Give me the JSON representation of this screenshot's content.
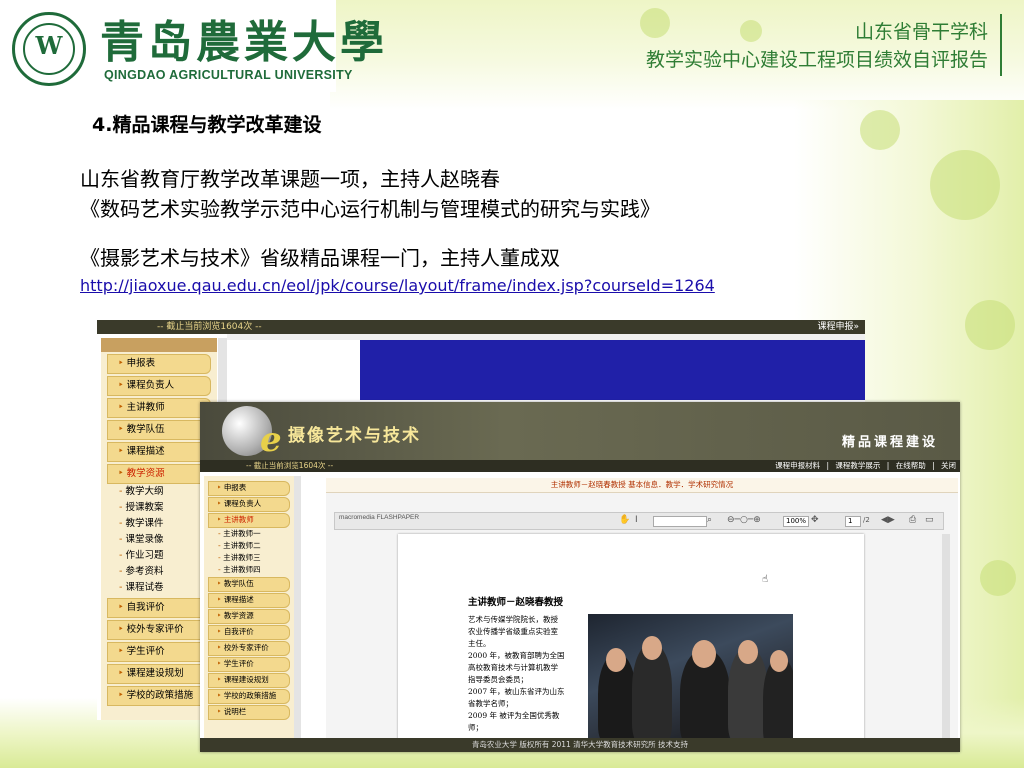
{
  "slide": {
    "logo": {
      "name_cn": "青岛農業大學",
      "name_en": "QINGDAO AGRICULTURAL UNIVERSITY"
    },
    "header": {
      "line1": "山东省骨干学科",
      "line2": "教学实验中心建设工程项目绩效自评报告"
    },
    "section_title": "4.精品课程与教学改革建设",
    "para1_line1": "山东省教育厅教学改革课题一项，主持人赵晓春",
    "para1_line2": "《数码艺术实验教学示范中心运行机制与管理模式的研究与实践》",
    "para2": "《摄影艺术与技术》省级精品课程一门，主持人董成双",
    "link": "http://jiaoxue.qau.edu.cn/eol/jpk/course/layout/frame/index.jsp?courseId=1264"
  },
  "back_screenshot": {
    "counter": "-- 截止当前浏览1604次 --",
    "top_right": "课程申报»",
    "menu": [
      {
        "label": "申报表",
        "type": "main"
      },
      {
        "label": "课程负责人",
        "type": "main"
      },
      {
        "label": "主讲教师",
        "type": "main"
      },
      {
        "label": "教学队伍",
        "type": "main"
      },
      {
        "label": "课程描述",
        "type": "main"
      },
      {
        "label": "教学资源",
        "type": "main",
        "selected": true
      },
      {
        "label": "教学大纲",
        "type": "sub"
      },
      {
        "label": "授课教案",
        "type": "sub"
      },
      {
        "label": "教学课件",
        "type": "sub"
      },
      {
        "label": "课堂录像",
        "type": "sub"
      },
      {
        "label": "作业习题",
        "type": "sub"
      },
      {
        "label": "参考资料",
        "type": "sub"
      },
      {
        "label": "课程试卷",
        "type": "sub"
      },
      {
        "label": "自我评价",
        "type": "main"
      },
      {
        "label": "校外专家评价",
        "type": "main"
      },
      {
        "label": "学生评价",
        "type": "main"
      },
      {
        "label": "课程建设规划",
        "type": "main"
      },
      {
        "label": "学校的政策措施",
        "type": "main"
      }
    ],
    "scroll_label": "|||"
  },
  "front_screenshot": {
    "banner_title": "摄像艺术与技术",
    "banner_right": "精品课程建设",
    "counter": "-- 截止当前浏览1604次 --",
    "top_links": "课程申报材料 | 课程教学展示 | 在线帮助 | 关闭",
    "breadcrumb": "主讲教师－赵晓春教授 基本信息．教学．学术研究情况",
    "flashpaper": "macromedia FLASHPAPER",
    "zoom": "100%",
    "page_num": "1",
    "page_total": "/2",
    "menu": [
      {
        "label": "申报表",
        "type": "main"
      },
      {
        "label": "课程负责人",
        "type": "main"
      },
      {
        "label": "主讲教师",
        "type": "main",
        "selected": true
      },
      {
        "label": "主讲教师一",
        "type": "sub"
      },
      {
        "label": "主讲教师二",
        "type": "sub"
      },
      {
        "label": "主讲教师三",
        "type": "sub"
      },
      {
        "label": "主讲教师四",
        "type": "sub"
      },
      {
        "label": "教学队伍",
        "type": "main"
      },
      {
        "label": "课程描述",
        "type": "main"
      },
      {
        "label": "教学资源",
        "type": "main"
      },
      {
        "label": "自我评价",
        "type": "main"
      },
      {
        "label": "校外专家评价",
        "type": "main"
      },
      {
        "label": "学生评价",
        "type": "main"
      },
      {
        "label": "课程建设规划",
        "type": "main"
      },
      {
        "label": "学校的政策措施",
        "type": "main"
      },
      {
        "label": "说明栏",
        "type": "main"
      }
    ],
    "doc_title": "主讲教师－赵晓春教授",
    "doc_lines": [
      "艺术与传媒学院院长，教授",
      "农业传播学省级重点实验室",
      "主任。",
      "2000 年，被教育部聘为全国",
      "高校教育技术与计算机教学",
      "指导委员会委员；",
      "2007 年，被山东省评为山东",
      "省教学名师；",
      "2009  年  被评为全国优秀教",
      "师；"
    ],
    "footer": "青岛农业大学 版权所有 2011 清华大学教育技术研究所 技术支持"
  },
  "colors": {
    "header_green": "#2f7d35",
    "logo_green": "#1f6b3a",
    "link_blue": "#1a0dab",
    "menu_gold": "#f3d98e"
  }
}
